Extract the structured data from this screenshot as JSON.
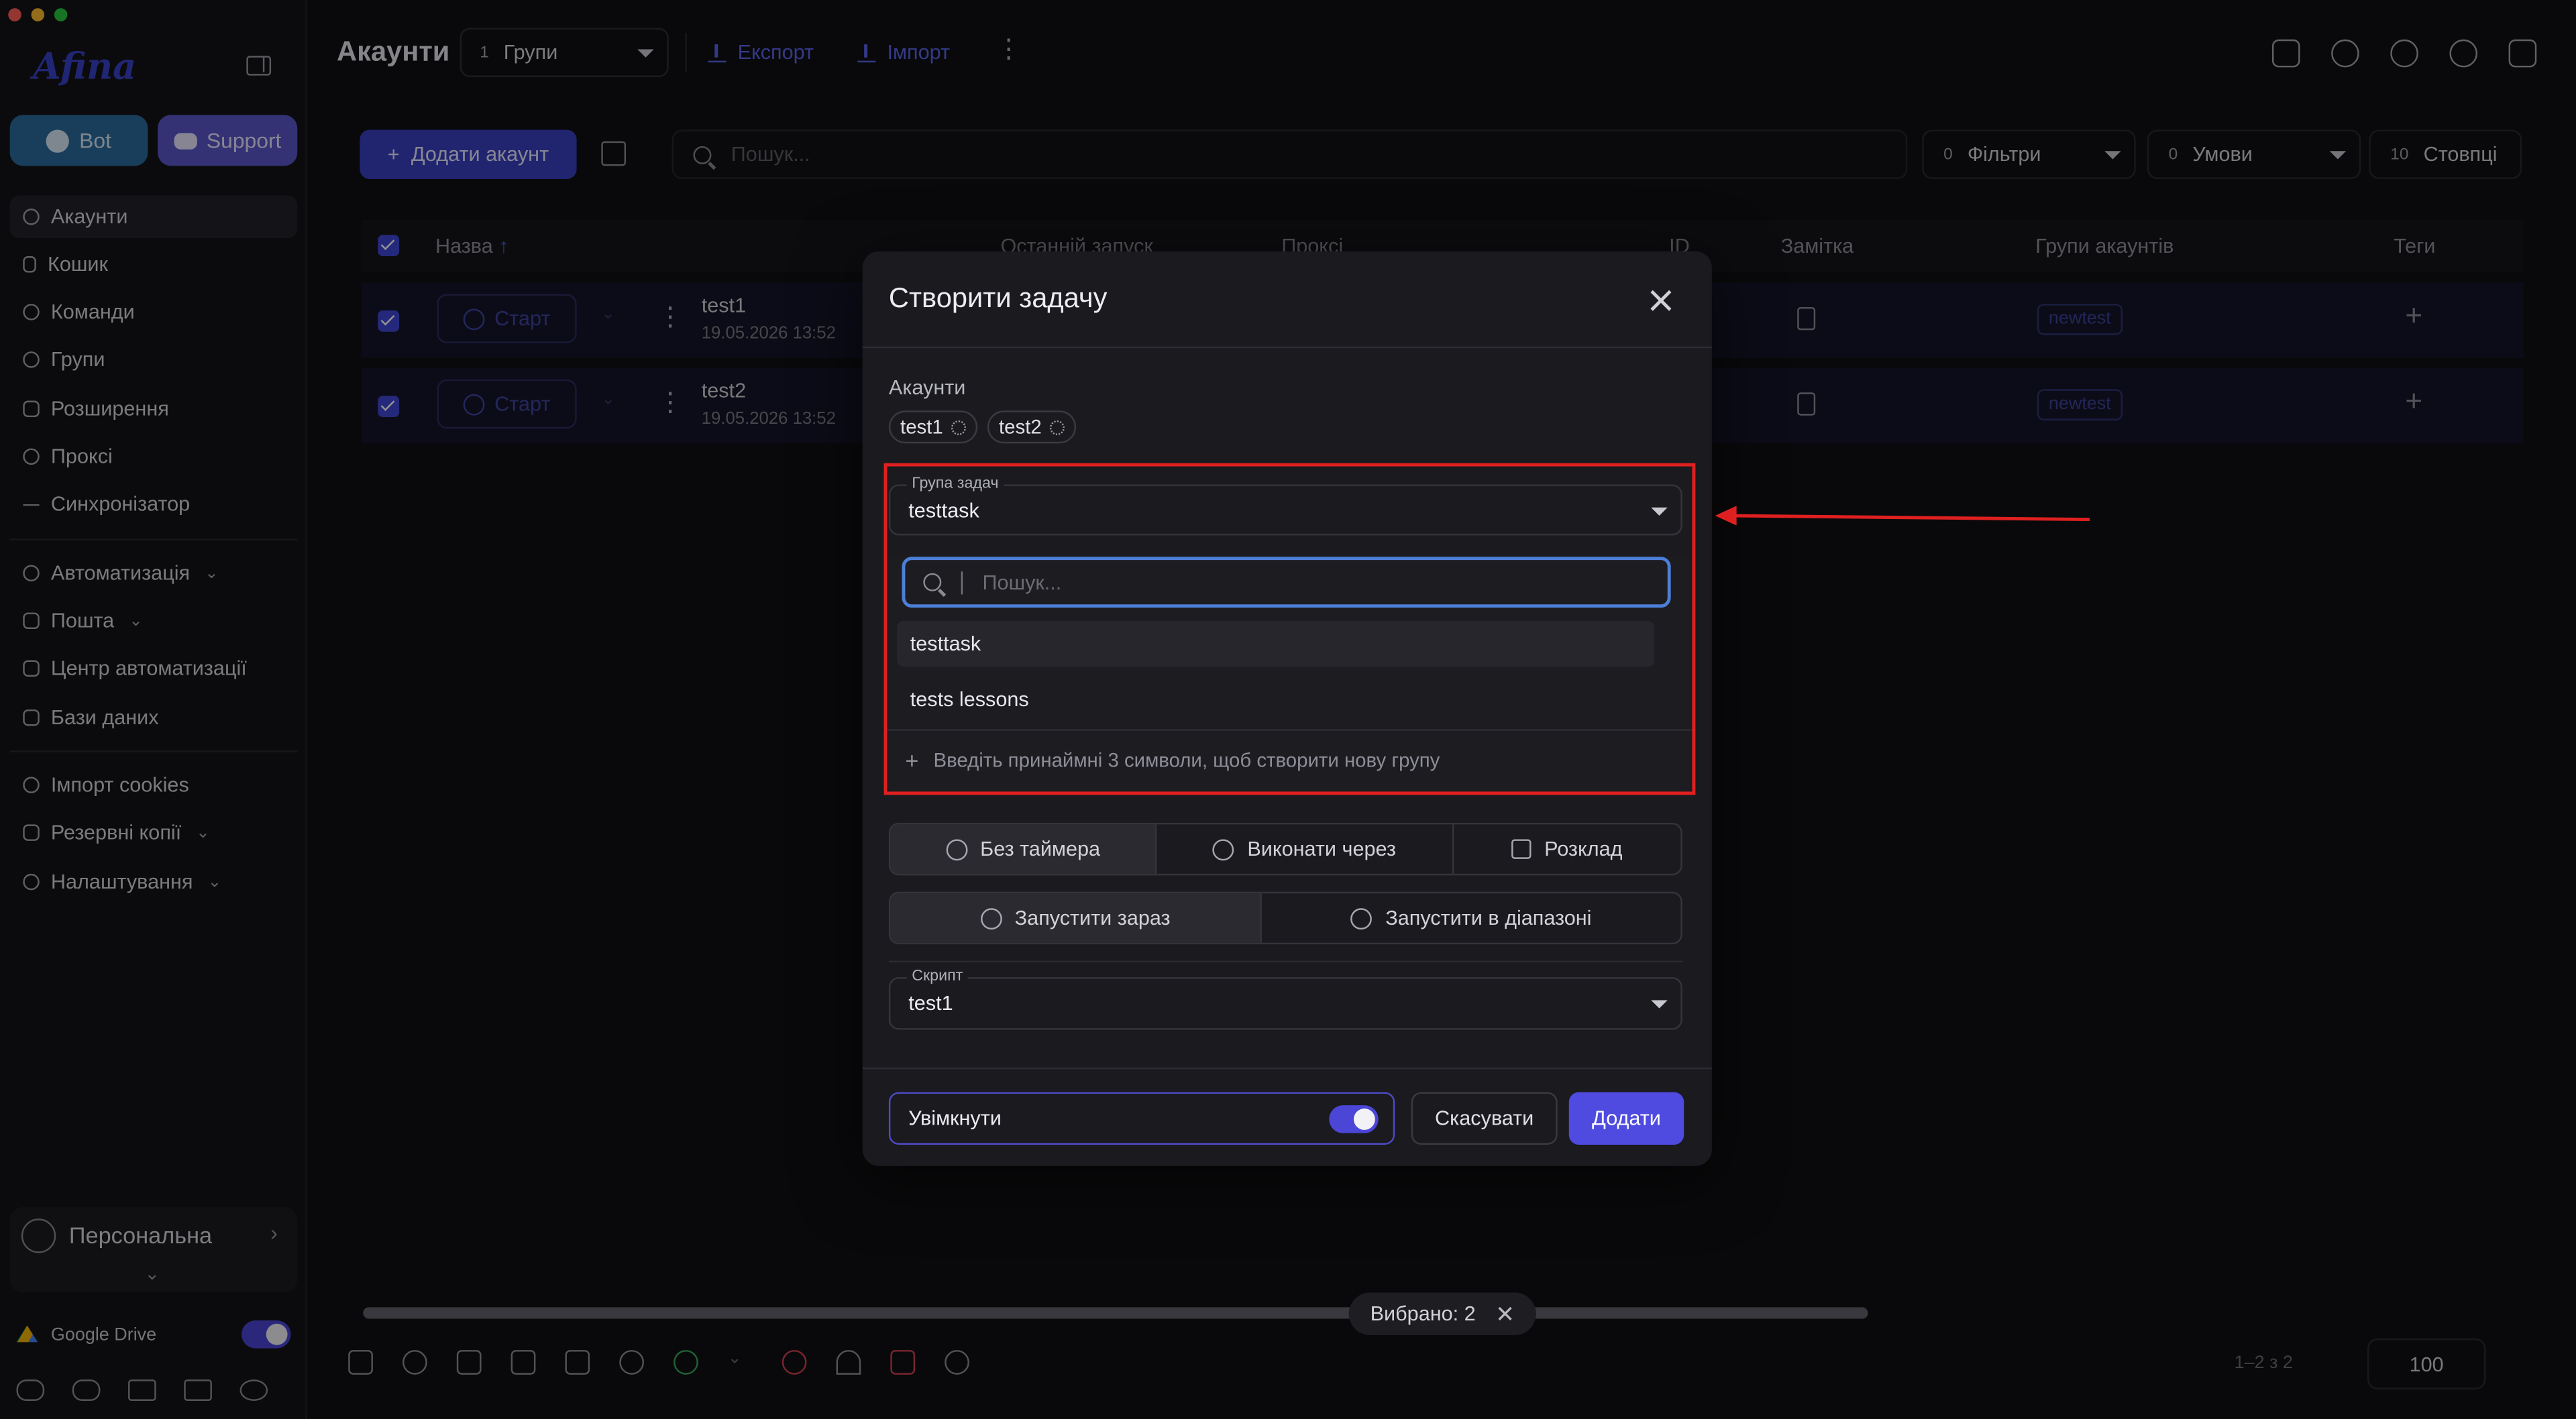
{
  "window": {
    "traffic_colors": [
      "#ff5f57",
      "#febc2e",
      "#28c840"
    ]
  },
  "sidebar": {
    "logo": "Afina",
    "bot_label": "Bot",
    "support_label": "Support",
    "nav_top": [
      {
        "label": "Акаунти",
        "active": true
      },
      {
        "label": "Кошик"
      },
      {
        "label": "Команди"
      },
      {
        "label": "Групи"
      },
      {
        "label": "Розширення"
      },
      {
        "label": "Проксі"
      },
      {
        "label": "Синхронізатор"
      }
    ],
    "nav_mid": [
      {
        "label": "Автоматизація"
      },
      {
        "label": "Пошта"
      },
      {
        "label": "Центр автоматизації"
      },
      {
        "label": "Бази даних"
      }
    ],
    "nav_bottom": [
      {
        "label": "Імпорт cookies"
      },
      {
        "label": "Резервні копії"
      },
      {
        "label": "Налаштування"
      }
    ],
    "profile_name": "Персональна",
    "google_drive_label": "Google Drive",
    "google_drive_enabled": true
  },
  "header": {
    "title": "Акаунти",
    "group_count": "1",
    "group_label": "Групи",
    "export_label": "Експорт",
    "import_label": "Імпорт"
  },
  "toolbar": {
    "add_account_label": "Додати акаунт",
    "search_placeholder": "Пошук...",
    "filters_count": "0",
    "filters_label": "Фільтри",
    "conditions_count": "0",
    "conditions_label": "Умови",
    "columns_count": "10",
    "columns_label": "Стовпці"
  },
  "table": {
    "headers": {
      "name": "Назва",
      "last_launch": "Останній запуск",
      "proxy": "Проксі",
      "id": "ID",
      "note": "Замітка",
      "groups": "Групи акаунтів",
      "tags": "Теги"
    },
    "start_label": "Старт",
    "rows": [
      {
        "name": "test1",
        "date": "19.05.2026 13:52",
        "group": "newtest"
      },
      {
        "name": "test2",
        "date": "19.05.2026 13:52",
        "group": "newtest"
      }
    ]
  },
  "footer": {
    "selected_label": "Вибрано: 2",
    "pager_text": "1–2 з 2",
    "page_size": "100"
  },
  "modal": {
    "title": "Створити задачу",
    "accounts_label": "Акаунти",
    "account_chips": [
      "test1",
      "test2"
    ],
    "task_group_label": "Група задач",
    "task_group_value": "testtask",
    "dropdown": {
      "search_placeholder": "Пошук...",
      "options": [
        "testtask",
        "tests lessons"
      ],
      "selected": "testtask",
      "create_hint": "Введіть принаймні 3 символи, щоб створити нову групу"
    },
    "timer_options": [
      "Без таймера",
      "Виконати через",
      "Розклад"
    ],
    "run_options": [
      "Запустити зараз",
      "Запустити в діапазоні"
    ],
    "script_label": "Скрипт",
    "script_value": "test1",
    "enable_label": "Увімкнути",
    "enabled": true,
    "cancel_label": "Скасувати",
    "add_label": "Додати"
  },
  "colors": {
    "accent": "#4f4be0",
    "annotation": "#e02020",
    "focus": "#4c7fd8"
  }
}
